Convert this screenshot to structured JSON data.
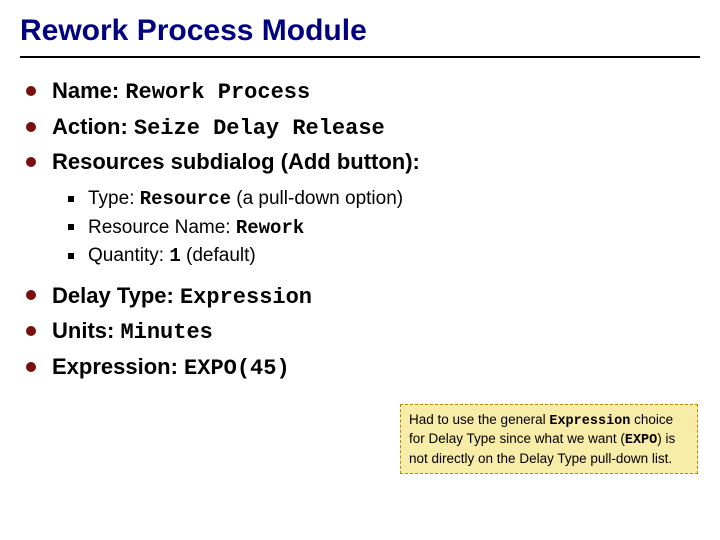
{
  "title": "Rework Process Module",
  "b1": {
    "label": "Name: ",
    "value": "Rework Process"
  },
  "b2": {
    "label": "Action: ",
    "value": "Seize Delay Release"
  },
  "b3": {
    "label": "Resources subdialog (Add button):"
  },
  "sub": {
    "s1a": "Type: ",
    "s1b": "Resource",
    "s1c": " (a pull-down option)",
    "s2a": "Resource Name: ",
    "s2b": "Rework",
    "s3a": "Quantity: ",
    "s3b": "1",
    "s3c": " (default)"
  },
  "b4": {
    "label": "Delay Type: ",
    "value": "Expression"
  },
  "b5": {
    "label": "Units: ",
    "value": "Minutes"
  },
  "b6": {
    "label": "Expression: ",
    "value": "EXPO(45)"
  },
  "note": {
    "p1": "Had to use the general ",
    "p2": "Expression",
    "p3": " choice for Delay Type since what we want (",
    "p4": "EXPO",
    "p5": ") is not directly on the Delay Type pull-down list."
  }
}
